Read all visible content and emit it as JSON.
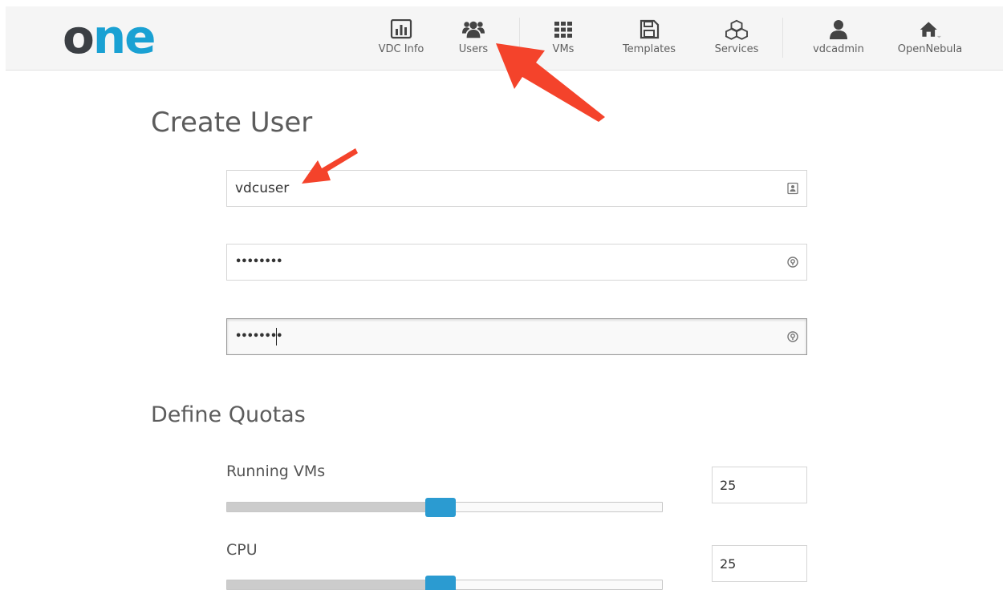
{
  "logo": {
    "part1": "o",
    "part2": "ne"
  },
  "nav": {
    "vdc_info": "VDC Info",
    "users": "Users",
    "vms": "VMs",
    "templates": "Templates",
    "services": "Services",
    "user": "vdcadmin",
    "zone": "OpenNebula"
  },
  "form": {
    "title": "Create User",
    "username": "vdcuser",
    "password_mask": "••••••••",
    "confirm_mask": "••••••••"
  },
  "quotas": {
    "title": "Define Quotas",
    "running_vms": {
      "label": "Running VMs",
      "value": "25",
      "fraction": 0.49
    },
    "cpu": {
      "label": "CPU",
      "value": "25",
      "fraction": 0.49
    }
  },
  "colors": {
    "accent": "#2b9bd1",
    "logo_blue": "#1aa1d3",
    "annotation_arrow": "#f4432b"
  },
  "icons": [
    "chart-icon",
    "users-icon",
    "grid-icon",
    "save-icon",
    "cubes-icon",
    "user-icon",
    "home-icon",
    "contact-card-icon",
    "key-icon"
  ]
}
